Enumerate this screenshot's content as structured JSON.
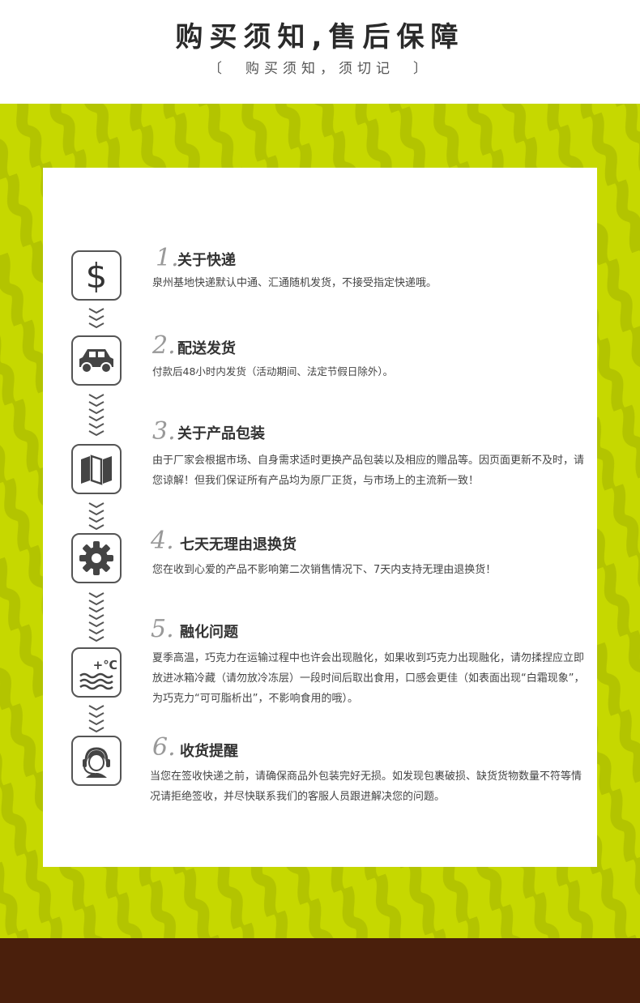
{
  "header": {
    "title": "购买须知,售后保障",
    "subtitle": "〔　购买须知，须切记　〕"
  },
  "colors": {
    "accent": "#c6d800",
    "accent_dark": "#b3c400",
    "footer": "#4a1f0c"
  },
  "sections": [
    {
      "number": "1.",
      "title": "关于快递",
      "icon": "dollar-icon",
      "body": "泉州基地快递默认中通、汇通随机发货，不接受指定快递哦。"
    },
    {
      "number": "2.",
      "title": "配送发货",
      "icon": "car-icon",
      "body": "付款后48小时内发货（活动期间、法定节假日除外）。"
    },
    {
      "number": "3.",
      "title": "关于产品包装",
      "icon": "map-icon",
      "body": "由于厂家会根据市场、自身需求适时更换产品包装以及相应的赠品等。因页面更新不及时，请您谅解！但我们保证所有产品均为原厂正货，与市场上的主流新一致！"
    },
    {
      "number": "4.",
      "title": "七天无理由退换货",
      "icon": "gear-icon",
      "body": "您在收到心爱的产品不影响第二次销售情况下、7天内支持无理由退换货！"
    },
    {
      "number": "5.",
      "title": "融化问题",
      "icon": "temperature-icon",
      "body": "夏季高温，巧克力在运输过程中也许会出现融化，如果收到巧克力出现融化，请勿揉捏应立即放进冰箱冷藏（请勿放冷冻层）一段时间后取出食用，口感会更佳（如表面出现“白霜现象”，为巧克力“可可脂析出”，不影响食用的哦）。"
    },
    {
      "number": "6.",
      "title": "收货提醒",
      "icon": "customer-service-icon",
      "body": "当您在签收快递之前，请确保商品外包装完好无损。如发现包裹破损、缺货货物数量不符等情况请拒绝签收，并尽快联系我们的客服人员跟进解决您的问题。"
    }
  ],
  "temperature_label": "+℃"
}
